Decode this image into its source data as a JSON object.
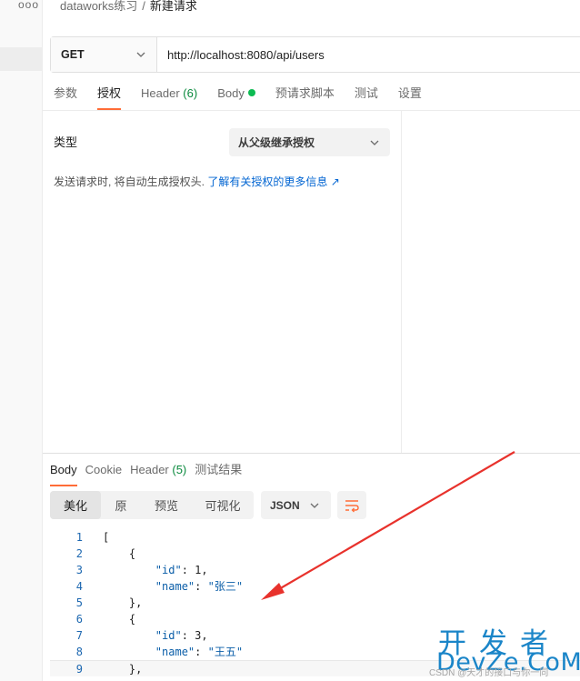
{
  "breadcrumb": {
    "workspace": "dataworks练习",
    "separator": "/",
    "request": "新建请求"
  },
  "sidebar": {
    "more_icon": "more-dots-icon",
    "more_label": "ooo"
  },
  "request": {
    "method": "GET",
    "url": "http://localhost:8080/api/users"
  },
  "request_tabs": [
    {
      "label": "参数"
    },
    {
      "label": "授权",
      "active": true
    },
    {
      "label": "Header",
      "count": "(6)"
    },
    {
      "label": "Body",
      "has_dot": true
    },
    {
      "label": "预请求脚本"
    },
    {
      "label": "测试"
    },
    {
      "label": "设置"
    }
  ],
  "auth": {
    "type_label": "类型",
    "type_value": "从父级继承授权",
    "hint": "发送请求时, 将自动生成授权头.",
    "hint_link": "了解有关授权的更多信息 ↗"
  },
  "response_tabs": [
    {
      "label": "Body",
      "active": true
    },
    {
      "label": "Cookie"
    },
    {
      "label": "Header",
      "count": "(5)"
    },
    {
      "label": "测试结果"
    }
  ],
  "view_modes": [
    "美化",
    "原",
    "预览",
    "可视化"
  ],
  "active_view": "美化",
  "format": "JSON",
  "code_lines": [
    {
      "n": "1",
      "text": "["
    },
    {
      "n": "2",
      "text": "    {"
    },
    {
      "n": "3",
      "key": "\"id\"",
      "val": "1",
      "trail": ","
    },
    {
      "n": "4",
      "key": "\"name\"",
      "str": "\"张三\""
    },
    {
      "n": "5",
      "text": "    },"
    },
    {
      "n": "6",
      "text": "    {"
    },
    {
      "n": "7",
      "key": "\"id\"",
      "val": "3",
      "trail": ","
    },
    {
      "n": "8",
      "key": "\"name\"",
      "str": "\"王五\""
    },
    {
      "n": "9",
      "text": "    },"
    }
  ],
  "watermark": {
    "line1": "开发者",
    "line2": "DevZe.CoM",
    "credit": "CSDN @天才的接口与你一同"
  },
  "colors": {
    "accent": "#ff6c37",
    "link": "#0265d2",
    "arrow": "#e8322c",
    "watermark": "#1a85c8"
  }
}
